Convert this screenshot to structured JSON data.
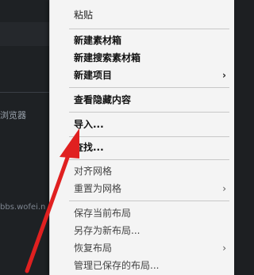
{
  "background": {
    "texts": [
      "浏览器",
      "bbs.wofei.n"
    ],
    "accent": "#1e2124"
  },
  "menu": {
    "items": [
      {
        "label": "粘贴",
        "style": "normal",
        "submenu": false
      },
      {
        "label": "新建素材箱",
        "style": "bold",
        "submenu": false
      },
      {
        "label": "新建搜索素材箱",
        "style": "bold",
        "submenu": false
      },
      {
        "label": "新建项目",
        "style": "bold",
        "submenu": true
      },
      {
        "label": "查看隐藏内容",
        "style": "bold",
        "submenu": false
      },
      {
        "label": "导入...",
        "style": "bold",
        "submenu": false
      },
      {
        "label": "查找...",
        "style": "bold",
        "submenu": false
      },
      {
        "label": "对齐网格",
        "style": "normal",
        "submenu": false
      },
      {
        "label": "重置为网格",
        "style": "normal",
        "submenu": true
      },
      {
        "label": "保存当前布局",
        "style": "normal",
        "submenu": false
      },
      {
        "label": "另存为新布局...",
        "style": "normal",
        "submenu": false
      },
      {
        "label": "恢复布局",
        "style": "normal",
        "submenu": true
      },
      {
        "label": "管理已保存的布局...",
        "style": "normal",
        "submenu": false
      }
    ],
    "chevron": "›"
  },
  "annotation": {
    "icon": "red-arrow-icon",
    "color": "#e02020"
  }
}
